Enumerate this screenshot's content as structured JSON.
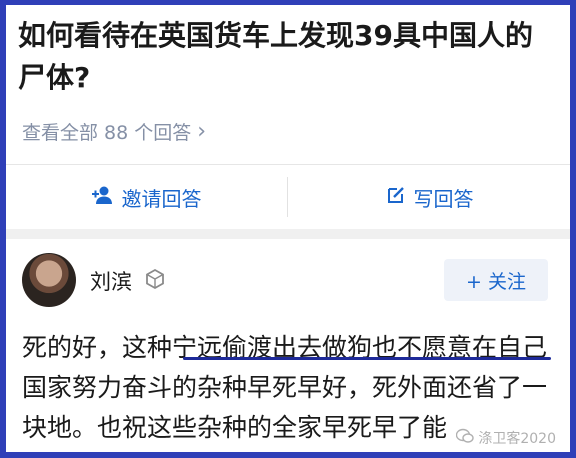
{
  "question": {
    "title": "如何看待在英国货车上发现39具中国人的尸体?"
  },
  "answers_link": {
    "label": "查看全部 88 个回答",
    "chevron": "›"
  },
  "actions": {
    "invite_label": "邀请回答",
    "write_label": "写回答",
    "invite_icon": "add-user-icon",
    "write_icon": "edit-icon"
  },
  "answer": {
    "author": "刘滨",
    "follow_label": "+ 关注",
    "text": "死的好，这种宁远偷渡出去做狗也不愿意在自己国家努力奋斗的杂种早死早好，死外面还省了一块地。也祝这些杂种的全家早死早了能"
  },
  "watermark": {
    "text": "涤卫客2020"
  },
  "colors": {
    "accent": "#1a66cc",
    "frame": "#2f3fb8",
    "underline": "#1e2a99"
  }
}
